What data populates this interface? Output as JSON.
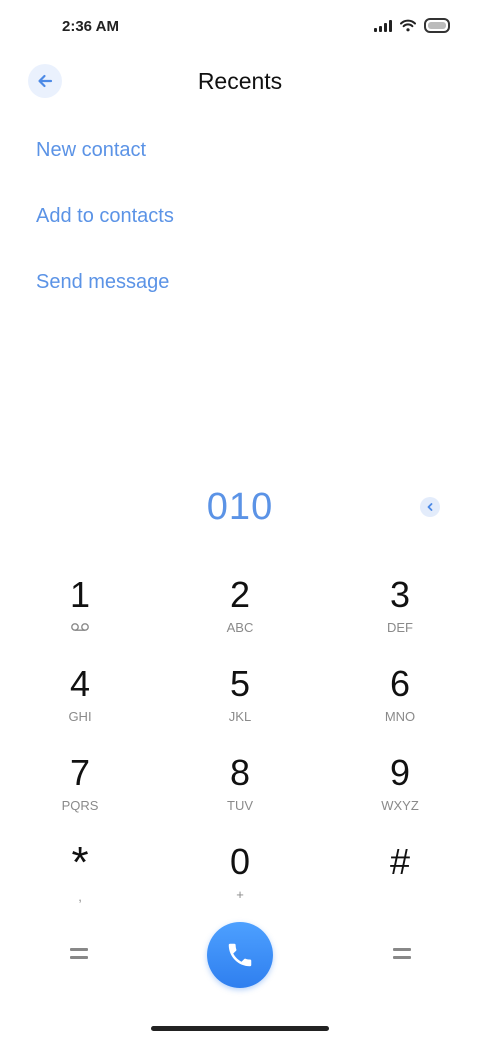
{
  "status_bar": {
    "time": "2:36 AM"
  },
  "header": {
    "title": "Recents",
    "back_icon": "arrow-left-icon"
  },
  "actions": [
    "New contact",
    "Add to contacts",
    "Send message"
  ],
  "dialer": {
    "number": "010",
    "delete_icon": "backspace-icon"
  },
  "keys": [
    {
      "digit": "1",
      "letters": ""
    },
    {
      "digit": "2",
      "letters": "ABC"
    },
    {
      "digit": "3",
      "letters": "DEF"
    },
    {
      "digit": "4",
      "letters": "GHI"
    },
    {
      "digit": "5",
      "letters": "JKL"
    },
    {
      "digit": "6",
      "letters": "MNO"
    },
    {
      "digit": "7",
      "letters": "PQRS"
    },
    {
      "digit": "8",
      "letters": "TUV"
    },
    {
      "digit": "9",
      "letters": "WXYZ"
    },
    {
      "digit": "*",
      "letters": ","
    },
    {
      "digit": "0",
      "letters": "+"
    },
    {
      "digit": "#",
      "letters": ""
    }
  ],
  "colors": {
    "accent": "#5b93e6",
    "call_button": "#3a8bf5"
  }
}
